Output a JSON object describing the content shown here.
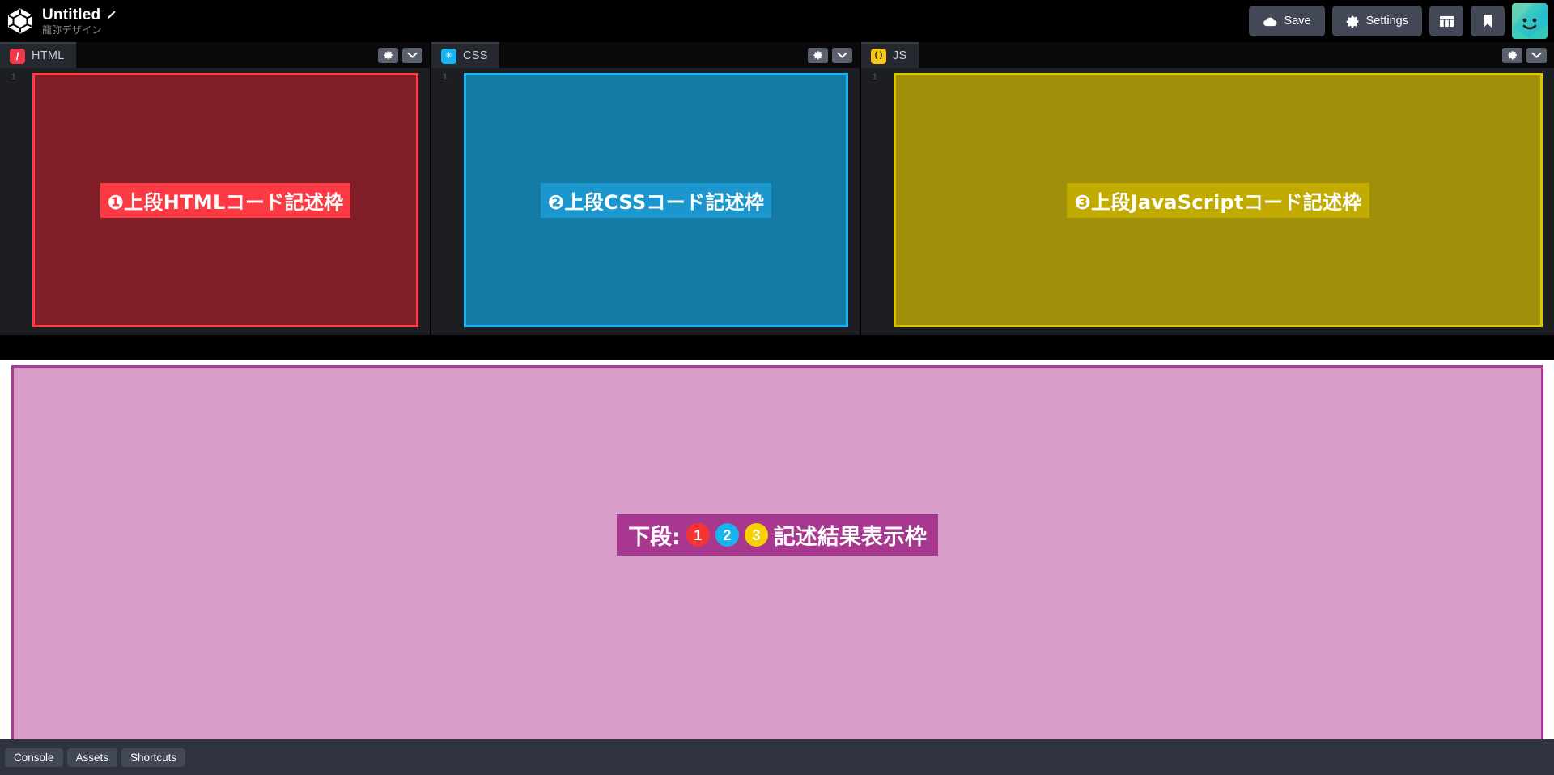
{
  "topbar": {
    "logo_icon": "cube-logo-icon",
    "title": "Untitled",
    "edit_icon": "pencil-icon",
    "subtitle": "龍弥デザイン",
    "buttons": [
      {
        "label": "Save",
        "icon": "cloud-icon",
        "name": "save-button"
      },
      {
        "label": "Settings",
        "icon": "gear-icon",
        "name": "settings-button"
      }
    ],
    "layout_button": {
      "icon": "layout-grid-icon",
      "name": "change-view-button"
    },
    "bookmark_button": {
      "icon": "bookmark-icon",
      "name": "bookmark-button"
    },
    "avatar": {
      "icon": "user-avatar-smiley",
      "name": "avatar"
    }
  },
  "editors": [
    {
      "id": "html",
      "tab_label": "HTML",
      "badge_glyph": "/",
      "badge_color": "#f0384a",
      "gutter_line": "1",
      "annotation_label": "❶上段HTMLコード記述枠",
      "annotation_fill": "#be1e2a",
      "annotation_border": "#ff3b44",
      "label_bg": "#fb3a43",
      "settings_icon": "gear-icon",
      "collapse_icon": "chevron-down-icon"
    },
    {
      "id": "css",
      "tab_label": "CSS",
      "badge_glyph": "✳",
      "badge_color": "#16b5f0",
      "gutter_line": "1",
      "annotation_label": "❷上段CSSコード記述枠",
      "annotation_fill": "#1482af",
      "annotation_border": "#1ab5f5",
      "label_bg": "#1b97cd",
      "settings_icon": "gear-icon",
      "collapse_icon": "chevron-down-icon"
    },
    {
      "id": "js",
      "tab_label": "JS",
      "badge_glyph": "( )",
      "badge_color": "#f5c518",
      "gutter_line": "1",
      "annotation_label": "❸上段JavaScriptコード記述枠",
      "annotation_fill": "#a89609",
      "annotation_border": "#dbc400",
      "label_bg": "#c2ab00",
      "settings_icon": "gear-icon",
      "collapse_icon": "chevron-down-icon"
    }
  ],
  "preview": {
    "bg_color": "#d79cc7",
    "border_color": "#ab3a96",
    "label_bg": "#a8388f",
    "label_prefix": "下段:",
    "label_suffix": "記述結果表示枠",
    "badges": [
      {
        "text": "1",
        "color": "#f53333"
      },
      {
        "text": "2",
        "color": "#16b5f0"
      },
      {
        "text": "3",
        "color": "#f7d000"
      }
    ]
  },
  "statusbar": {
    "buttons": [
      {
        "label": "Console",
        "name": "console-button"
      },
      {
        "label": "Assets",
        "name": "assets-button"
      },
      {
        "label": "Shortcuts",
        "name": "shortcuts-button"
      }
    ]
  }
}
